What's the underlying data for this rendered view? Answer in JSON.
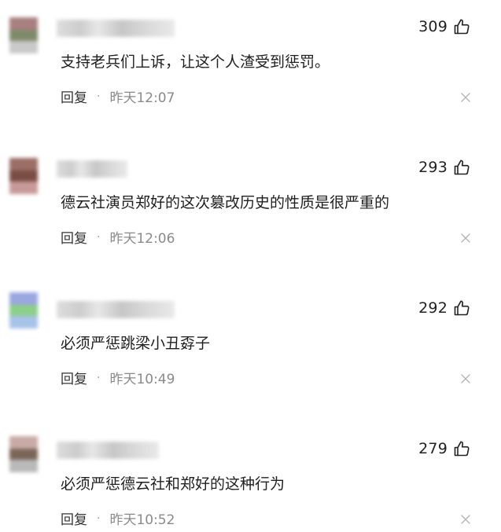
{
  "comments": [
    {
      "likes": "309",
      "text": "支持老兵们上诉，让这个人渣受到惩罚。",
      "reply_label": "回复",
      "separator": "·",
      "time": "昨天12:07",
      "avatar_colors": [
        "#a98080",
        "#7f8a6a",
        "#c9c9c9"
      ]
    },
    {
      "likes": "293",
      "text": "德云社演员郑好的这次篡改历史的性质是很严重的",
      "reply_label": "回复",
      "separator": "·",
      "time": "昨天12:06",
      "avatar_colors": [
        "#9a6f66",
        "#7a4d44",
        "#c79a9a"
      ]
    },
    {
      "likes": "292",
      "text": "必须严惩跳梁小丑孬子",
      "reply_label": "回复",
      "separator": "·",
      "time": "昨天10:49",
      "avatar_colors": [
        "#9aa7e0",
        "#8ccf8a",
        "#a7c3e8"
      ]
    },
    {
      "likes": "279",
      "text": "必须严惩德云社和郑好的这种行为",
      "reply_label": "回复",
      "separator": "·",
      "time": "昨天10:52",
      "avatar_colors": [
        "#c9aaa6",
        "#7a6658",
        "#b9b9b9"
      ]
    }
  ]
}
